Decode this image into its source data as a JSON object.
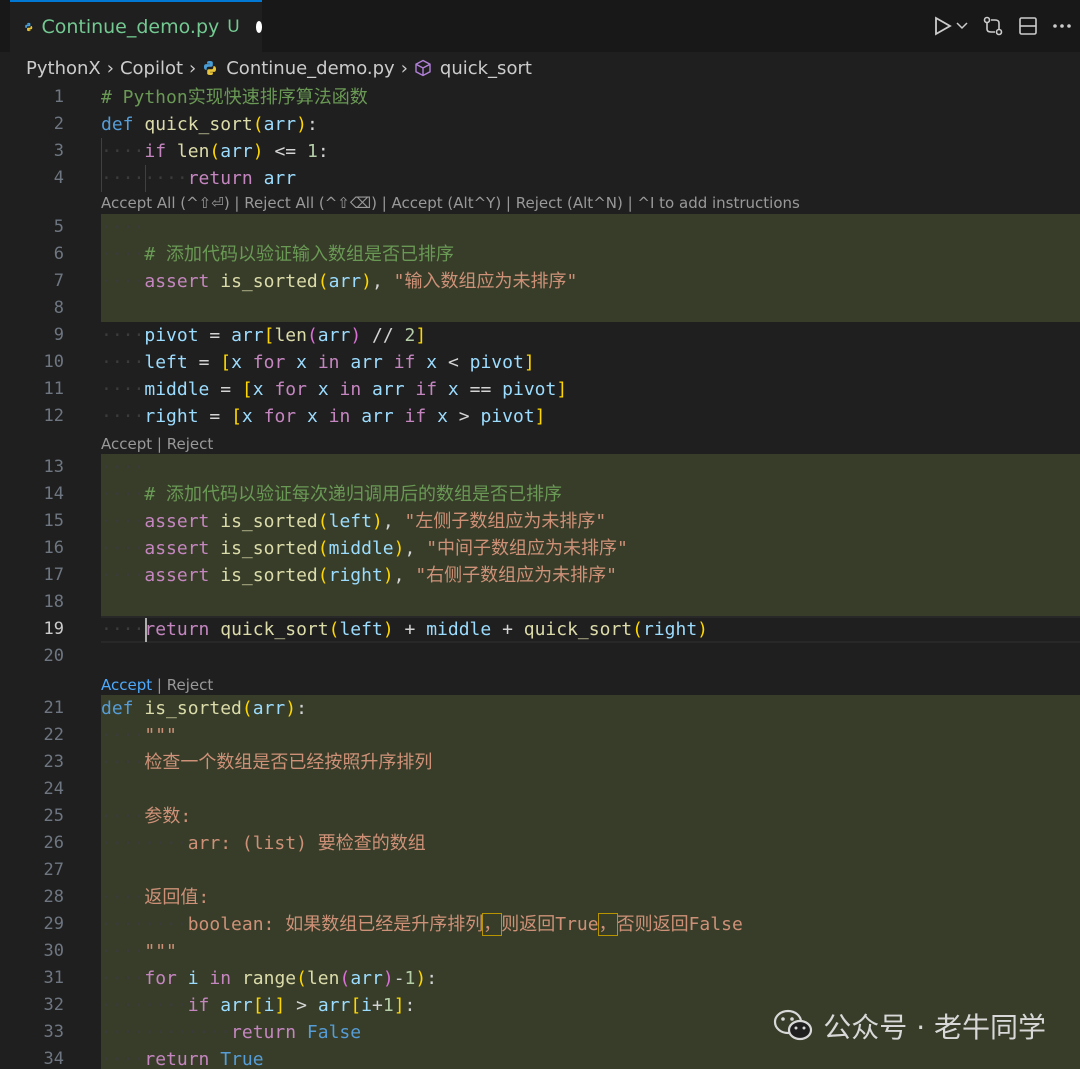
{
  "tab": {
    "filename": "Continue_demo.py",
    "status": "U"
  },
  "breadcrumb": [
    "PythonX",
    "Copilot",
    "Continue_demo.py",
    "quick_sort"
  ],
  "codelens": {
    "top": "Accept All (^⇧⏎) | Reject All (^⇧⌫) | Accept (Alt^Y) | Reject (Alt^N) | ^I to add instructions",
    "accept": "Accept",
    "sep": " | ",
    "reject": "Reject"
  },
  "gutter": [
    "1",
    "2",
    "3",
    "4",
    "5",
    "6",
    "7",
    "8",
    "9",
    "10",
    "11",
    "12",
    "13",
    "14",
    "15",
    "16",
    "17",
    "18",
    "19",
    "20",
    "21",
    "22",
    "23",
    "24",
    "25",
    "26",
    "27",
    "28",
    "29",
    "30",
    "31",
    "32",
    "33",
    "34"
  ],
  "code": {
    "l1": "# Python实现快速排序算法函数",
    "def": "def",
    "quick_sort": "quick_sort",
    "is_sorted": "is_sorted",
    "arr": "arr",
    "left": "left",
    "middle": "middle",
    "right": "right",
    "pivot": "pivot",
    "x": "x",
    "i": "i",
    "if": "if",
    "for": "for",
    "in": "in",
    "return": "return",
    "assert": "assert",
    "len": "len",
    "range": "range",
    "one": "1",
    "two": "2",
    "false": "False",
    "true": "True",
    "c6": "# 添加代码以验证输入数组是否已排序",
    "s7": "\"输入数组应为未排序\"",
    "c14": "# 添加代码以验证每次递归调用后的数组是否已排序",
    "s15": "\"左侧子数组应为未排序\"",
    "s16": "\"中间子数组应为未排序\"",
    "s17": "\"右侧子数组应为未排序\"",
    "docq": "\"\"\"",
    "d23": "检查一个数组是否已经按照升序排列",
    "d25": "参数:",
    "d26": "arr: (list) 要检查的数组",
    "d28": "返回值:",
    "d29a": "boolean: 如果数组已经是升序排列",
    "d29b": "，",
    "d29c": "则返回True",
    "d29d": "否则返回False"
  },
  "watermark": "公众号 · 老牛同学",
  "colors": {
    "accent": "#0078d4",
    "added_bg": "#373d29",
    "untracked": "#73c991"
  }
}
